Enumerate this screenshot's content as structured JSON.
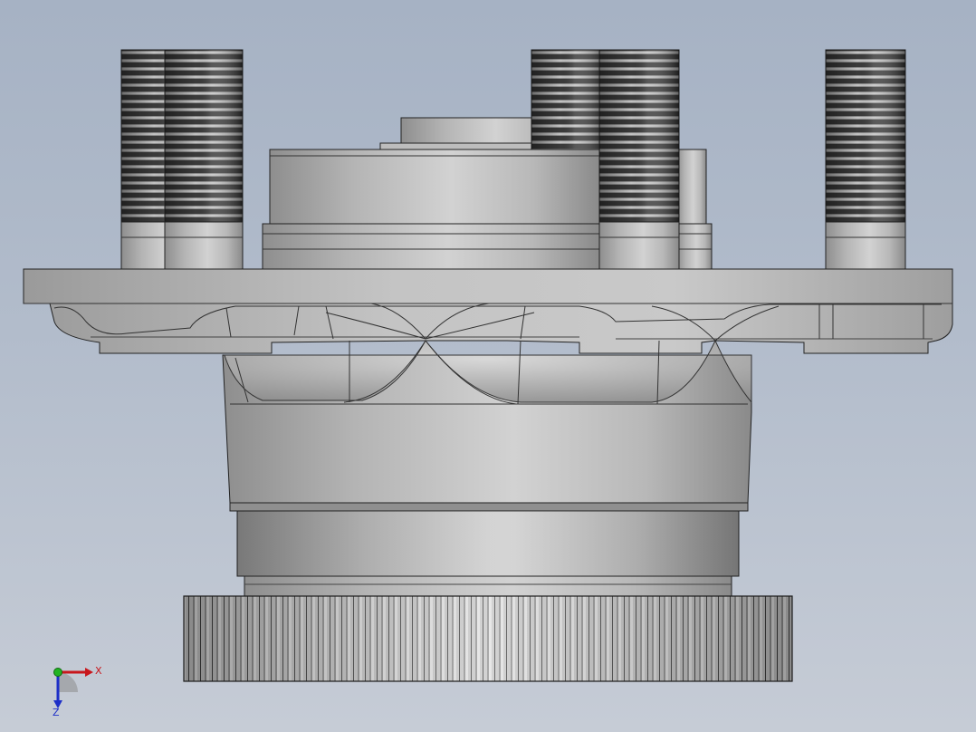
{
  "viewport": {
    "background_top": "#a6b2c4",
    "background_bottom": "#c6ccd6",
    "model": "wheel-hub-assembly"
  },
  "triad": {
    "x_label": "X",
    "z_label": "Z",
    "x_color": "#c8171c",
    "z_color": "#1d2fc8",
    "y_color": "#21b321"
  }
}
